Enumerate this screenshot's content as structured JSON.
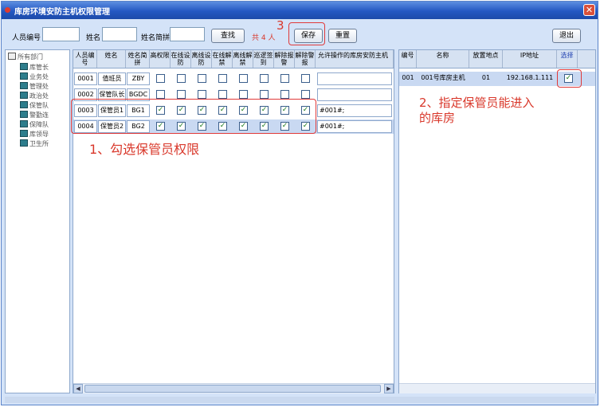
{
  "window": {
    "title": "库房环境安防主机权限管理"
  },
  "toolbar": {
    "id_label": "人员编号",
    "id_value": "",
    "name_label": "姓名",
    "name_value": "",
    "pinyin_label": "姓名简拼",
    "pinyin_value": "",
    "search_label": "查找",
    "count_text": "共 4 人",
    "save_label": "保存",
    "reset_label": "重置",
    "exit_label": "退出"
  },
  "annotations": {
    "step3": "3",
    "step1": "1、勾选保管员权限",
    "step2_line1": "2、指定保管员能进入",
    "step2_line2": "的库房"
  },
  "tree": {
    "root": "所有部门",
    "items": [
      "库管长",
      "业务处",
      "管理处",
      "政治处",
      "保管队",
      "警勤连",
      "保障队",
      "库领导",
      "卫生所"
    ]
  },
  "staff_grid": {
    "headers": [
      "人员编号",
      "姓名",
      "姓名简拼",
      "高权限",
      "在线设防",
      "离线设防",
      "在线解禁",
      "离线解禁",
      "巡逻签到",
      "解除报警",
      "解除警报",
      "允许操作的库房安防主机"
    ],
    "rows": [
      {
        "id": "0001",
        "name": "值班员",
        "pinyin": "ZBY",
        "checks": [
          false,
          false,
          false,
          false,
          false,
          false,
          false,
          false
        ],
        "hosts": ""
      },
      {
        "id": "0002",
        "name": "保管队长",
        "pinyin": "BGDC",
        "checks": [
          false,
          false,
          false,
          false,
          false,
          false,
          false,
          false
        ],
        "hosts": ""
      },
      {
        "id": "0003",
        "name": "保管员1",
        "pinyin": "BG1",
        "checks": [
          true,
          true,
          true,
          true,
          true,
          true,
          true,
          true
        ],
        "hosts": "#001#;"
      },
      {
        "id": "0004",
        "name": "保管员2",
        "pinyin": "BG2",
        "checks": [
          true,
          true,
          true,
          true,
          true,
          true,
          true,
          true
        ],
        "hosts": "#001#;"
      }
    ]
  },
  "host_grid": {
    "headers": [
      "编号",
      "名称",
      "放置地点",
      "IP地址",
      "选择"
    ],
    "rows": [
      {
        "no": "001",
        "name": "001号库房主机",
        "location": "01",
        "ip": "192.168.1.111",
        "selected": true
      }
    ]
  }
}
